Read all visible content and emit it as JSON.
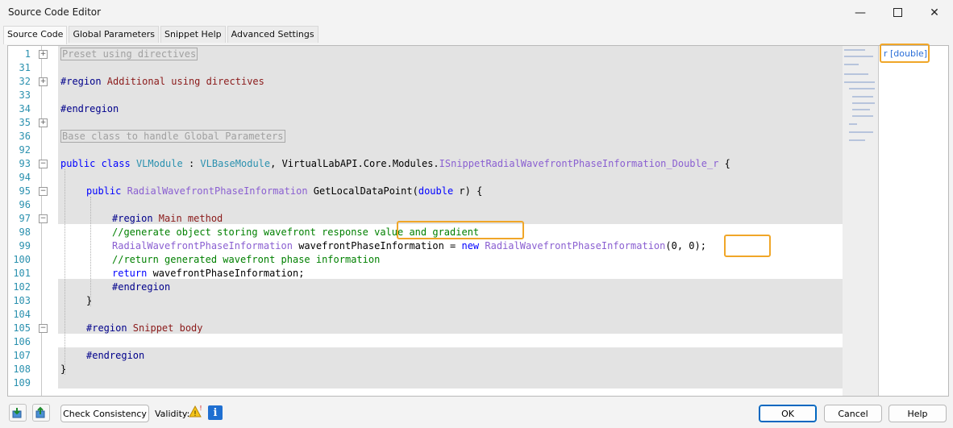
{
  "window": {
    "title": "Source Code Editor"
  },
  "tabs": [
    {
      "label": "Source Code",
      "active": true
    },
    {
      "label": "Global Parameters",
      "active": false
    },
    {
      "label": "Snippet Help",
      "active": false
    },
    {
      "label": "Advanced Settings",
      "active": false
    }
  ],
  "editor": {
    "line_numbers": [
      "1",
      "31",
      "32",
      "33",
      "34",
      "35",
      "36",
      "92",
      "93",
      "94",
      "95",
      "96",
      "97",
      "98",
      "99",
      "100",
      "101",
      "102",
      "103",
      "104",
      "105",
      "106",
      "107",
      "108",
      "109"
    ],
    "lines": {
      "l1": "Preset using directives",
      "l32a": "#region",
      "l32b": " Additional using directives",
      "l34": "#endregion",
      "l36": "Base class to handle Global Parameters",
      "l93_kw": "public class",
      "l93_cls": "VLModule",
      "l93_colon": " : ",
      "l93_base": "VLBaseModule",
      "l93_mid": ", VirtualLabAPI.Core.Modules.",
      "l93_iface": "ISnippetRadialWavefrontPhaseInformation_Double_r",
      "l93_end": " {",
      "l95_kw": "public",
      "l95_type": "RadialWavefrontPhaseInformation",
      "l95_mid": " GetLocalDataPoint(",
      "l95_kw2": "double",
      "l95_end": " r) {",
      "l97_dir": "#region",
      "l97_name": " Main method",
      "l98_comment": "//generate object storing wavefront response value and gradient",
      "l99_type": "RadialWavefrontPhaseInformation",
      "l99_mid": " wavefrontPhaseInformation = ",
      "l99_new": "new",
      "l99_type2": "RadialWavefrontPhaseInformation",
      "l99_args": "(0, 0)",
      "l99_end": ";",
      "l100_comment": "//return generated wavefront phase information",
      "l101_kw": "return",
      "l101_rest": " wavefrontPhaseInformation;",
      "l102_dir": "#endregion",
      "l103": "}",
      "l105_dir": "#region",
      "l105_name": " Snippet body",
      "l107_dir": "#endregion",
      "l108": "}"
    }
  },
  "right_panel": {
    "parameter": "r [double]"
  },
  "bottom": {
    "check_consistency_label": "Check Consistency",
    "validity_label": "Validity:",
    "ok_label": "OK",
    "cancel_label": "Cancel",
    "help_label": "Help"
  },
  "icons": {
    "validity_warning": "warning-icon",
    "info": "info-icon",
    "import": "import-icon",
    "export": "export-icon"
  },
  "colors": {
    "highlight": "#f0a628",
    "keyword": "#0000ff",
    "type": "#2b91af",
    "comment": "#008000",
    "region_name": "#8b1a1a",
    "ok_border": "#0067c0"
  }
}
